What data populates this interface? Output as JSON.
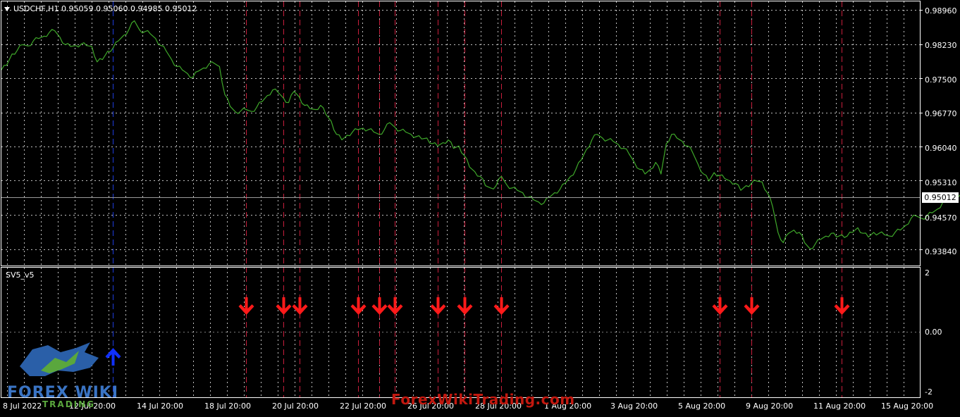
{
  "header": {
    "title": "USDCHF,H1  0.95059 0.95060 0.94985 0.95012"
  },
  "indicator": {
    "name": "SV5_v5",
    "axis_labels": [
      "2",
      "0.00",
      "-2"
    ]
  },
  "price_axis": {
    "labels": [
      "0.98960",
      "0.98230",
      "0.97500",
      "0.96770",
      "0.96040",
      "0.95310",
      "0.94570",
      "0.93840"
    ],
    "current_price": "0.95012"
  },
  "time_axis": {
    "labels": [
      "8 Jul 2022",
      "12 Jul 20:00",
      "14 Jul 20:00",
      "18 Jul 20:00",
      "20 Jul 20:00",
      "22 Jul 20:00",
      "26 Jul 20:00",
      "28 Jul 20:00",
      "1 Aug 20:00",
      "3 Aug 20:00",
      "5 Aug 20:00",
      "9 Aug 20:00",
      "11 Aug 20:00",
      "15 Aug 20:00"
    ]
  },
  "branding": {
    "logo_text": "FOREX WIKI",
    "logo_sub": "TRADING",
    "watermark": "ForexWikiTrading.com"
  },
  "colors": {
    "background": "#000000",
    "price_line": "#3fa82a",
    "sell_signal": "#ff1a1a",
    "buy_signal": "#1030ff",
    "grid": "#bfbfbf"
  },
  "signals": {
    "buy_times": [
      21
    ],
    "sell_times": [
      46,
      53,
      56,
      67,
      71,
      74,
      82,
      87,
      94,
      135,
      141,
      158
    ]
  },
  "chart_data": {
    "type": "line",
    "symbol": "USDCHF",
    "timeframe": "H1",
    "ylim": [
      0.9349,
      0.991
    ],
    "x_range": [
      0,
      172
    ],
    "series": [
      {
        "values": [
          0.9768,
          0.9778,
          0.9802,
          0.981,
          0.9822,
          0.9819,
          0.983,
          0.9835,
          0.984,
          0.9848,
          0.9852,
          0.9838,
          0.9822,
          0.9818,
          0.982,
          0.9823,
          0.982,
          0.9818,
          0.9785,
          0.979,
          0.9808,
          0.9815,
          0.983,
          0.9842,
          0.9855,
          0.9873,
          0.9853,
          0.985,
          0.9845,
          0.9835,
          0.982,
          0.9808,
          0.979,
          0.9775,
          0.9768,
          0.976,
          0.9752,
          0.9765,
          0.9772,
          0.978,
          0.9782,
          0.9775,
          0.9715,
          0.969,
          0.9678,
          0.968,
          0.9683,
          0.9679,
          0.9688,
          0.97,
          0.9713,
          0.9725,
          0.972,
          0.9708,
          0.9698,
          0.9722,
          0.971,
          0.9692,
          0.9685,
          0.9683,
          0.9692,
          0.9673,
          0.9658,
          0.963,
          0.9618,
          0.9628,
          0.9635,
          0.964,
          0.9643,
          0.964,
          0.9635,
          0.963,
          0.964,
          0.9655,
          0.9645,
          0.9638,
          0.9635,
          0.963,
          0.9625,
          0.962,
          0.9622,
          0.961,
          0.9605,
          0.9612,
          0.9618,
          0.96,
          0.9605,
          0.9585,
          0.956,
          0.955,
          0.954,
          0.952,
          0.9515,
          0.952,
          0.954,
          0.9522,
          0.9515,
          0.951,
          0.9505,
          0.9495,
          0.949,
          0.9485,
          0.9483,
          0.9495,
          0.9505,
          0.9512,
          0.9525,
          0.954,
          0.9555,
          0.9575,
          0.9598,
          0.9618,
          0.963,
          0.9622,
          0.9618,
          0.9615,
          0.9608,
          0.96,
          0.9588,
          0.957,
          0.9555,
          0.9545,
          0.9555,
          0.957,
          0.9545,
          0.961,
          0.963,
          0.9622,
          0.9615,
          0.9605,
          0.959,
          0.9565,
          0.9545,
          0.953,
          0.9548,
          0.9542,
          0.9535,
          0.953,
          0.9525,
          0.951,
          0.952,
          0.9525,
          0.953,
          0.9528,
          0.9505,
          0.9475,
          0.942,
          0.9398,
          0.9418,
          0.9425,
          0.942,
          0.9398,
          0.9385,
          0.9395,
          0.9405,
          0.9412,
          0.9418,
          0.941,
          0.9415,
          0.9412,
          0.942,
          0.943,
          0.9418,
          0.941,
          0.942,
          0.9418,
          0.9415,
          0.9412,
          0.942,
          0.9425,
          0.9435,
          0.945,
          0.9455,
          0.945,
          0.9455,
          0.9462,
          0.947,
          0.9485,
          0.9498,
          0.9502,
          0.9497,
          0.9501
        ]
      }
    ]
  }
}
